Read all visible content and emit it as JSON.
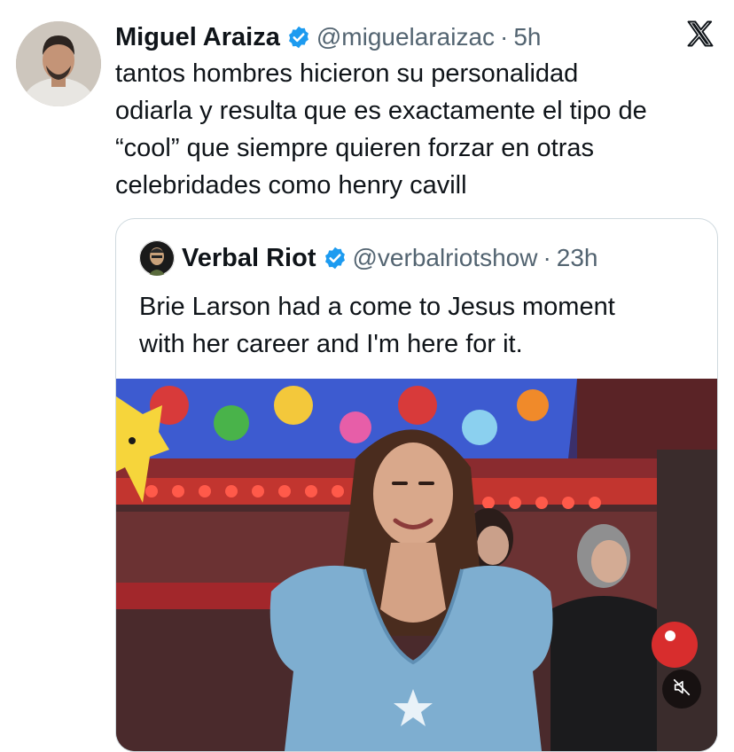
{
  "tweet": {
    "author": {
      "display_name": "Miguel Araiza",
      "handle": "@miguelaraizac",
      "verified": true
    },
    "separator": "·",
    "time": "5h",
    "text": "tantos hombres hicieron su personalidad\nodiarla y resulta que es exactamente el tipo de\n“cool” que siempre quieren forzar en otras\ncelebridades como henry cavill"
  },
  "quoted_tweet": {
    "author": {
      "display_name": "Verbal Riot",
      "handle": "@verbalriotshow",
      "verified": true
    },
    "separator": "·",
    "time": "23h",
    "text": "Brie Larson had a come to Jesus moment\nwith her career and I'm here for it.",
    "media": {
      "type": "video",
      "muted": true
    }
  },
  "colors": {
    "text_primary": "#0f1419",
    "text_secondary": "#536471",
    "verified_blue": "#1d9bf0",
    "card_border": "#cfd9de"
  },
  "icons": [
    "verified-badge-icon",
    "x-logo-icon",
    "mute-icon"
  ]
}
